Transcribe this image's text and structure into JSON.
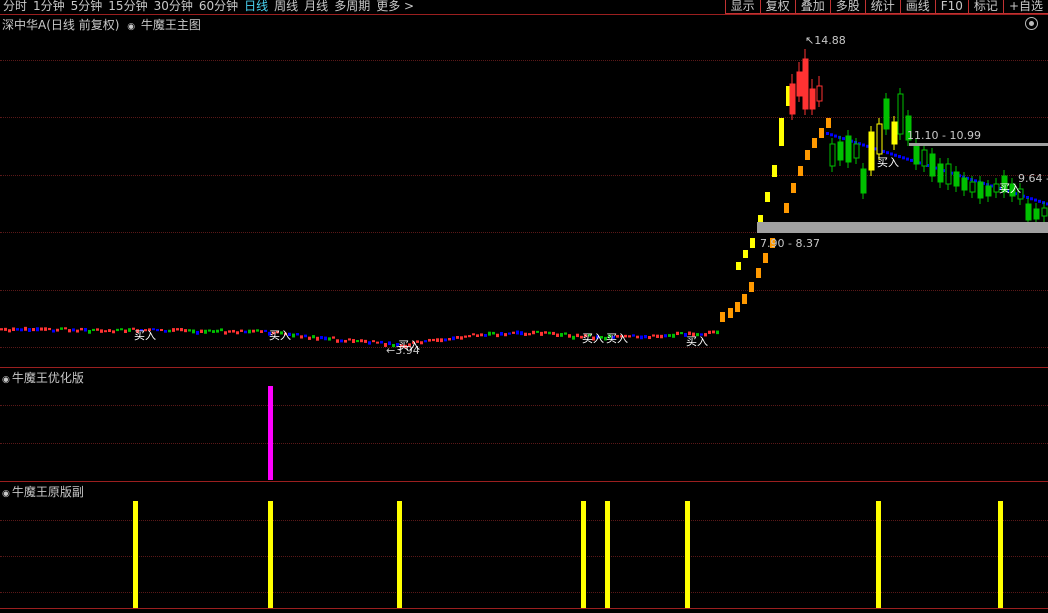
{
  "toolbar": {
    "periods": [
      "分时",
      "1分钟",
      "5分钟",
      "15分钟",
      "30分钟",
      "60分钟",
      "日线",
      "周线",
      "月线",
      "多周期",
      "更多 >"
    ],
    "active_period": "日线",
    "right_buttons": [
      "显示",
      "复权",
      "叠加",
      "多股",
      "统计",
      "画线",
      "F10",
      "标记",
      "+自选"
    ]
  },
  "main_panel": {
    "title": "深中华A(日线 前复权)",
    "indicator": "牛魔王主图",
    "high_label": "14.88",
    "low_label": "3.94",
    "zone_upper_label": "11.10 - 10.99",
    "zone_lower_label": "7.90 - 8.37",
    "zone_right_label": "9.64 -",
    "buy_label": "买入"
  },
  "sub_panel_1": {
    "title": "牛魔王优化版"
  },
  "sub_panel_2": {
    "title": "牛魔王原版副"
  },
  "colors": {
    "up": "#ff3232",
    "down": "#00c000",
    "buy_yellow": "#ffff00",
    "trend_blue": "#0000ff",
    "trend_orange": "#ff9900",
    "magenta": "#ff00ff",
    "zone_grey": "#a0a0a0"
  }
}
